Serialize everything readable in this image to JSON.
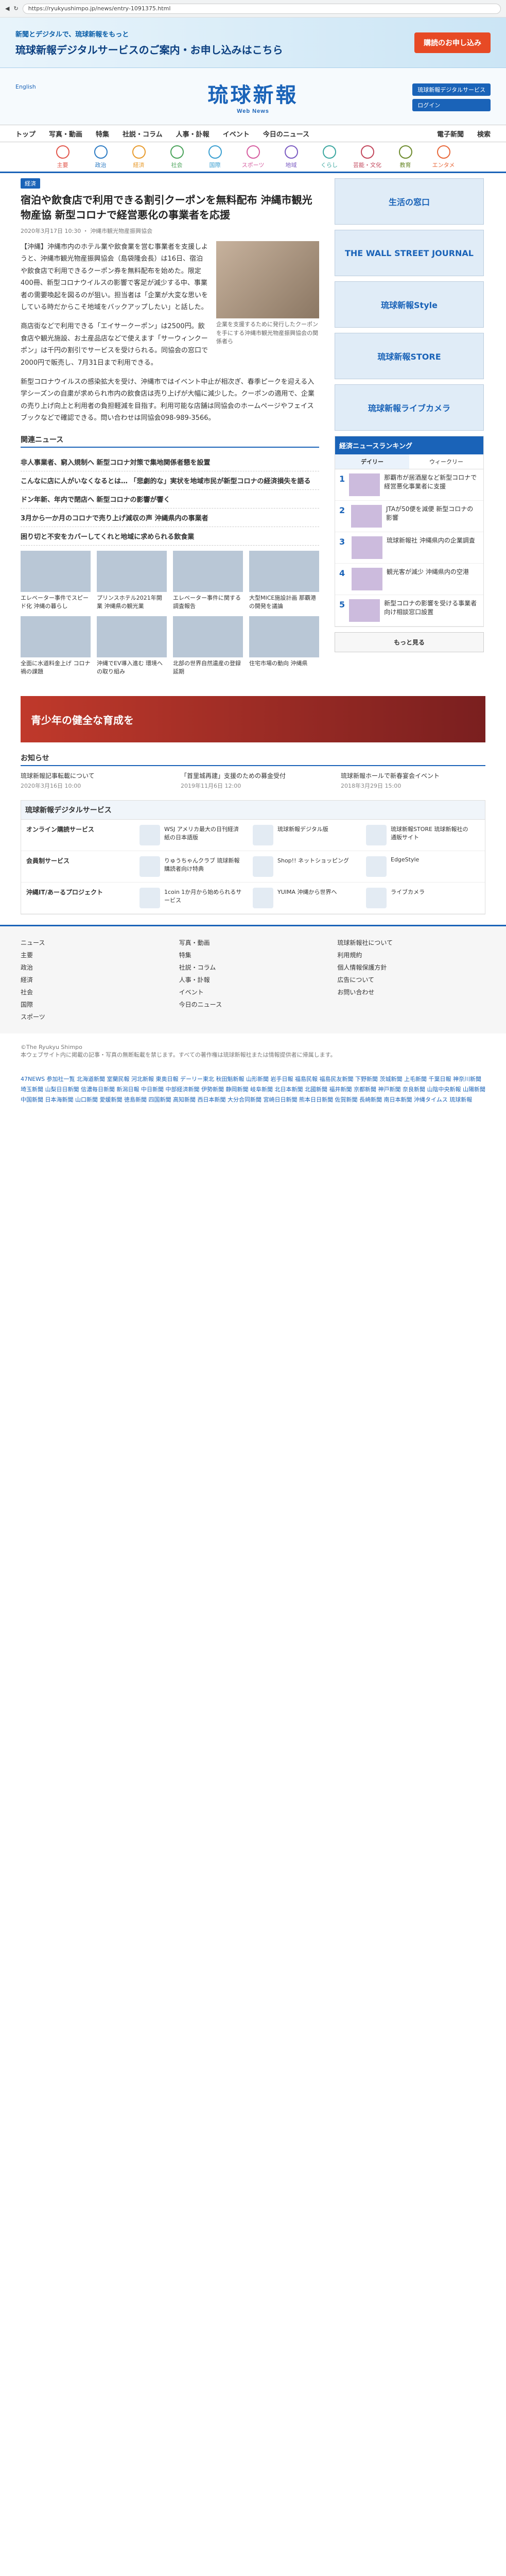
{
  "browser": {
    "url": "https://ryukyushimpo.jp/news/entry-1091375.html"
  },
  "promo": {
    "line1": "新聞とデジタルで、琉球新報をもっと",
    "line2": "琉球新報デジタルサービスのご案内・お申し込みはこちら",
    "cta": "購読のお申し込み"
  },
  "logo": {
    "title": "琉球新報",
    "sub": "Web News",
    "left_label": "English",
    "btn1": "琉球新報デジタルサービス",
    "btn2": "ログイン"
  },
  "nav": {
    "items": [
      "トップ",
      "写真・動画",
      "特集",
      "社説・コラム",
      "人事・訃報",
      "イベント",
      "今日のニュース"
    ],
    "e_paper": "電子新聞",
    "search": "検索"
  },
  "categories": [
    "主要",
    "政治",
    "経済",
    "社会",
    "国際",
    "スポーツ",
    "地域",
    "くらし",
    "芸能・文化",
    "教育",
    "エンタメ"
  ],
  "article": {
    "kw": "経済",
    "title": "宿泊や飲食店で利用できる割引クーポンを無料配布 沖縄市観光物産協 新型コロナで経営悪化の事業者を応援",
    "date": "2020年3月17日 10:30",
    "source": "沖縄市観光物産振興協会",
    "photo_caption": "企業を支援するために発行したクーポンを手にする沖縄市観光物産振興協会の関係者ら",
    "p1": "【沖縄】沖縄市内のホテル業や飲食業を営む事業者を支援しようと、沖縄市観光物産振興協会（島袋隆会長）は16日、宿泊や飲食店で利用できるクーポン券を無料配布を始めた。限定400冊、新型コロナウイルスの影響で客足が減少する中、事業者の需要喚起を図るのが狙い。担当者は「企業が大変な思いをしている時だからこそ地域をバックアップしたい」と話した。",
    "p2": "商店街などで利用できる「エイサークーポン」は2500円。飲食店や観光施設、お土産品店などで使えます「サーウィンクーポン」は千円の割引でサービスを受けられる。同協会の窓口で2000円で販売し、7月31日まで利用できる。",
    "p3": "新型コロナウイルスの感染拡大を受け、沖縄市ではイベント中止が相次ぎ、春季ピークを迎える入学シーズンの自粛が求められ市内の飲食店は売り上げが大幅に減少した。クーポンの適用で、企業の売り上げ向上と利用者の負担軽減を目指す。利用可能な店舗は同協会のホームページやフェイスブックなどで確認できる。問い合わせは同協会098-989-3566。",
    "related_title": "関連ニュース",
    "related": [
      "非人事業者、窮入規制へ 新型コロナ対策で集地関係者懇を設置",
      "こんなに店に人がいなくなるとは… 「悲劇的な」実状を地域市民が新型コロナの経済損失を語る",
      "ドン年新、年内で閉店へ 新型コロナの影響が響く",
      "3月から一か月のコロナで売り上げ減収の声 沖縄県内の事業者",
      "困り切と不安をカバーしてくれと地域に求められる飲食業"
    ]
  },
  "sidebar": {
    "ad1": "生活の窓口",
    "ad2": "THE WALL STREET JOURNAL",
    "ad3": "琉球新報Style",
    "ad4": "琉球新報STORE",
    "ad5": "琉球新報ライブカメラ",
    "ranking_title": "経済ニュースランキング",
    "tabs": [
      "デイリー",
      "ウィークリー"
    ],
    "ranks": [
      "那覇市が居酒屋など新型コロナで経営悪化事業者に支援",
      "JTAが50便を減便 新型コロナの影響",
      "琉球新報社 沖縄県内の企業調査",
      "観光客が減少 沖縄県内の空港",
      "新型コロナの影響を受ける事業者向け相談窓口設置"
    ],
    "more": "もっと見る"
  },
  "cards": [
    "エレベーター事件でスピード化 沖縄の暮らし",
    "プリンスホテル2021年開業 沖縄県の観光業",
    "エレベーター事件に関する調査報告",
    "大型MICE施設計画 那覇港の開発を議論",
    "全面に水道料金上げ コロナ禍の課題",
    "沖縄でEV導入進む 環境への取り組み",
    "北部の世界自然遺産の登録延期",
    "住宅市場の動向 沖縄県"
  ],
  "banner": "青少年の健全な育成を",
  "notice": {
    "title": "お知らせ",
    "items": [
      {
        "t": "琉球新報記事転載について",
        "d": "2020年3月16日 10:00"
      },
      {
        "t": "「首里城再建」支援のための募金受付",
        "d": "2019年11月6日 12:00"
      },
      {
        "t": "琉球新報ホールで新春宴会イベント",
        "d": "2018年3月29日 15:00"
      }
    ]
  },
  "services": {
    "title": "琉球新報デジタルサービス",
    "rows": [
      {
        "label": "オンライン購読サービス",
        "items": [
          "WSJ アメリカ最大の日刊経済紙の日本語版",
          "琉球新報デジタル版 ",
          "琉球新報STORE 琉球新報社の通販サイト"
        ]
      },
      {
        "label": "会員制サービス",
        "items": [
          "りゅうちゃんクラブ 琉球新報購読者向け特典",
          "Shop!! ネットショッピング",
          "EdgeStyle"
        ]
      },
      {
        "label": "沖縄IT/あーるプロジェクト",
        "items": [
          "1coin 1か月から始められるサービス",
          "YUIMA 沖縄から世界へ",
          "ライブカメラ"
        ]
      }
    ]
  },
  "footer": {
    "cols": [
      [
        "ニュース",
        "主要",
        "政治",
        "経済",
        "社会",
        "国際",
        "スポーツ"
      ],
      [
        "写真・動画",
        "特集",
        "社説・コラム",
        "人事・訃報",
        "イベント",
        "今日のニュース"
      ],
      [
        "琉球新報社について",
        "利用規約",
        "個人情報保護方針",
        "広告について",
        "お問い合わせ"
      ]
    ],
    "copy": "©The Ryukyu Shimpo",
    "note": "本ウェブサイト内に掲載の記事・写真の無断転載を禁じます。すべての著作権は琉球新報社または情報提供者に帰属します。",
    "news47": "47NEWS 参加社一覧 北海道新聞 室蘭民報 河北新報 東奥日報 デーリー東北 秋田魁新報 山形新聞 岩手日報 福島民報 福島民友新聞 下野新聞 茨城新聞 上毛新聞 千葉日報 神奈川新聞 埼玉新聞 山梨日日新聞 信濃毎日新聞 新潟日報 中日新聞 中部経済新聞 伊勢新聞 静岡新聞 岐阜新聞 北日本新聞 北國新聞 福井新聞 京都新聞 神戸新聞 奈良新聞 山陰中央新報 山陽新聞 中国新聞 日本海新聞 山口新聞 愛媛新聞 徳島新聞 四国新聞 高知新聞 西日本新聞 大分合同新聞 宮崎日日新聞 熊本日日新聞 佐賀新聞 長崎新聞 南日本新聞 沖縄タイムス 琉球新報"
  }
}
